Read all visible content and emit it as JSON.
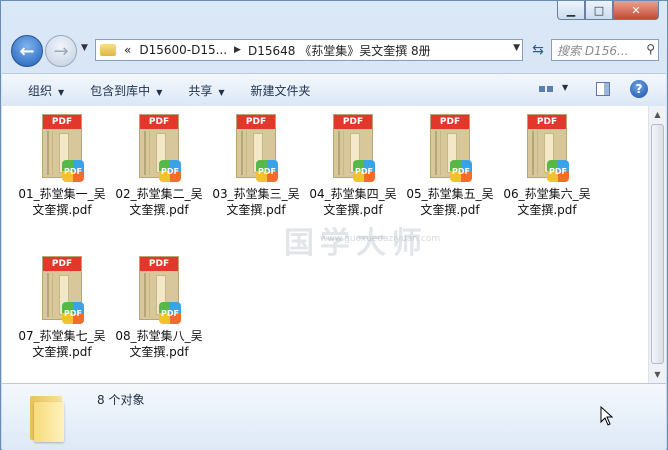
{
  "window": {
    "controls": [
      "minimize",
      "maximize",
      "close"
    ]
  },
  "nav": {
    "overflow_chevron": "«",
    "breadcrumb": [
      "D15600-D15...",
      "D15648 《荪堂集》吴文奎撰 8册"
    ],
    "search_placeholder": "搜索 D156..."
  },
  "toolbar": {
    "organize": "组织",
    "include_library": "包含到库中",
    "share": "共享",
    "new_folder": "新建文件夹"
  },
  "files": [
    {
      "name": "01_荪堂集一_吴文奎撰.pdf",
      "line1": "01_荪堂集一_吴",
      "line2": "文奎撰.pdf"
    },
    {
      "name": "02_荪堂集二_吴文奎撰.pdf",
      "line1": "02_荪堂集二_吴",
      "line2": "文奎撰.pdf"
    },
    {
      "name": "03_荪堂集三_吴文奎撰.pdf",
      "line1": "03_荪堂集三_吴",
      "line2": "文奎撰.pdf"
    },
    {
      "name": "04_荪堂集四_吴文奎撰.pdf",
      "line1": "04_荪堂集四_吴",
      "line2": "文奎撰.pdf"
    },
    {
      "name": "05_荪堂集五_吴文奎撰.pdf",
      "line1": "05_荪堂集五_吴",
      "line2": "文奎撰.pdf"
    },
    {
      "name": "06_荪堂集六_吴文奎撰.pdf",
      "line1": "06_荪堂集六_吴",
      "line2": "文奎撰.pdf"
    },
    {
      "name": "07_荪堂集七_吴文奎撰.pdf",
      "line1": "07_荪堂集七_吴",
      "line2": "文奎撰.pdf"
    },
    {
      "name": "08_荪堂集八_吴文奎撰.pdf",
      "line1": "08_荪堂集八_吴",
      "line2": "文奎撰.pdf"
    }
  ],
  "thumb_band": "PDF",
  "watermark": {
    "text": "国学大师",
    "url": "www.guoxuedaziyuan.com"
  },
  "status": {
    "count_text": "8 个对象"
  }
}
